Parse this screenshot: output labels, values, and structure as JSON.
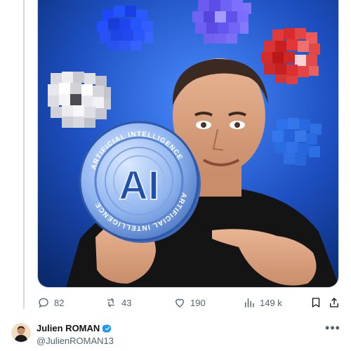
{
  "post": {
    "image_description_icon": "ai-coin-promo-image",
    "coin_text_top": "ARTIFICIAL INTELLIGENCE",
    "coin_text_bottom": "ARTIFICIAL INTELLIGENCE",
    "coin_center": "AI"
  },
  "actions": {
    "replies": "82",
    "reposts": "43",
    "likes": "190",
    "views": "149 k"
  },
  "author": {
    "name": "Julien ROMAN",
    "handle": "@JulienROMAN13"
  },
  "colors": {
    "accent": "#1d9bf0",
    "muted": "#536471",
    "bg_blue": "#1f5fd6"
  },
  "icons": [
    "reply-icon",
    "repost-icon",
    "like-icon",
    "views-icon",
    "bookmark-icon",
    "share-icon",
    "verified-icon",
    "more-icon"
  ]
}
